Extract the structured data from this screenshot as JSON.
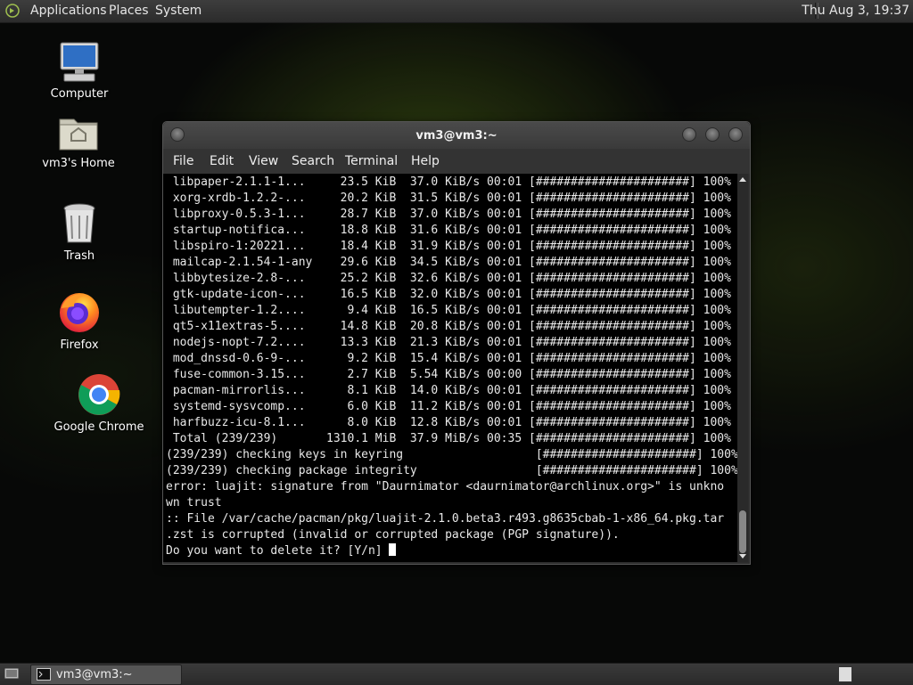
{
  "top_panel": {
    "menus": [
      "Applications",
      "Places",
      "System"
    ],
    "clock": "Thu Aug  3, 19:37"
  },
  "desktop_icons": [
    {
      "label": "Computer",
      "icon": "computer-icon"
    },
    {
      "label": "vm3's Home",
      "icon": "home-folder-icon"
    },
    {
      "label": "Trash",
      "icon": "trash-icon"
    },
    {
      "label": "Firefox",
      "icon": "firefox-icon"
    },
    {
      "label": "Google Chrome",
      "icon": "chrome-icon"
    }
  ],
  "window": {
    "title": "vm3@vm3:~",
    "menu": [
      "File",
      "Edit",
      "View",
      "Search",
      "Terminal",
      "Help"
    ]
  },
  "terminal": {
    "lines": [
      " libpaper-2.1.1-1...     23.5 KiB  37.0 KiB/s 00:01 [######################] 100%",
      " xorg-xrdb-1.2.2-...     20.2 KiB  31.5 KiB/s 00:01 [######################] 100%",
      " libproxy-0.5.3-1...     28.7 KiB  37.0 KiB/s 00:01 [######################] 100%",
      " startup-notifica...     18.8 KiB  31.6 KiB/s 00:01 [######################] 100%",
      " libspiro-1:20221...     18.4 KiB  31.9 KiB/s 00:01 [######################] 100%",
      " mailcap-2.1.54-1-any    29.6 KiB  34.5 KiB/s 00:01 [######################] 100%",
      " libbytesize-2.8-...     25.2 KiB  32.6 KiB/s 00:01 [######################] 100%",
      " gtk-update-icon-...     16.5 KiB  32.0 KiB/s 00:01 [######################] 100%",
      " libutempter-1.2....      9.4 KiB  16.5 KiB/s 00:01 [######################] 100%",
      " qt5-x11extras-5....     14.8 KiB  20.8 KiB/s 00:01 [######################] 100%",
      " nodejs-nopt-7.2....     13.3 KiB  21.3 KiB/s 00:01 [######################] 100%",
      " mod_dnssd-0.6-9-...      9.2 KiB  15.4 KiB/s 00:01 [######################] 100%",
      " fuse-common-3.15...      2.7 KiB  5.54 KiB/s 00:00 [######################] 100%",
      " pacman-mirrorlis...      8.1 KiB  14.0 KiB/s 00:01 [######################] 100%",
      " systemd-sysvcomp...      6.0 KiB  11.2 KiB/s 00:01 [######################] 100%",
      " harfbuzz-icu-8.1...      8.0 KiB  12.8 KiB/s 00:01 [######################] 100%",
      " Total (239/239)       1310.1 MiB  37.9 MiB/s 00:35 [######################] 100%",
      "(239/239) checking keys in keyring                   [######################] 100%",
      "(239/239) checking package integrity                 [######################] 100%",
      "error: luajit: signature from \"Daurnimator <daurnimator@archlinux.org>\" is unkno",
      "wn trust",
      ":: File /var/cache/pacman/pkg/luajit-2.1.0.beta3.r493.g8635cbab-1-x86_64.pkg.tar",
      ".zst is corrupted (invalid or corrupted package (PGP signature)).",
      "Do you want to delete it? [Y/n] "
    ]
  },
  "taskbar": {
    "task_label": "vm3@vm3:~"
  }
}
